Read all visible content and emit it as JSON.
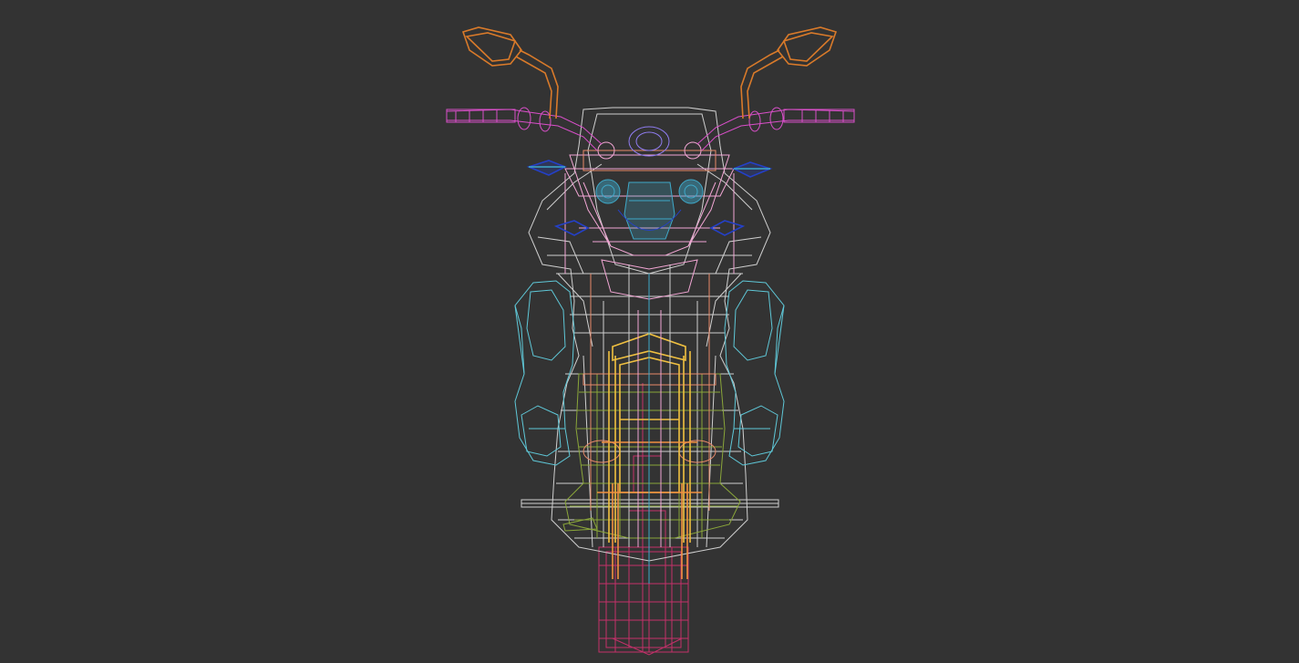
{
  "viewport": {
    "background": "#333333",
    "subject": "motorcycle-wireframe-front-view"
  },
  "colors": {
    "body_shell": "#cfcfcf",
    "fairing": "#f2a6d4",
    "side_panels": "#5fc8d8",
    "handlebars": "#d94fc9",
    "mirrors": "#d97a2a",
    "headlight_housing": "#8f7cf0",
    "headlights": "#3fa9c9",
    "turn_signals": "#2440c8",
    "fork": "#f0c040",
    "engine": "#8aa63a",
    "rear_wheel": "#c4306a",
    "forks_orange": "#f09040"
  }
}
